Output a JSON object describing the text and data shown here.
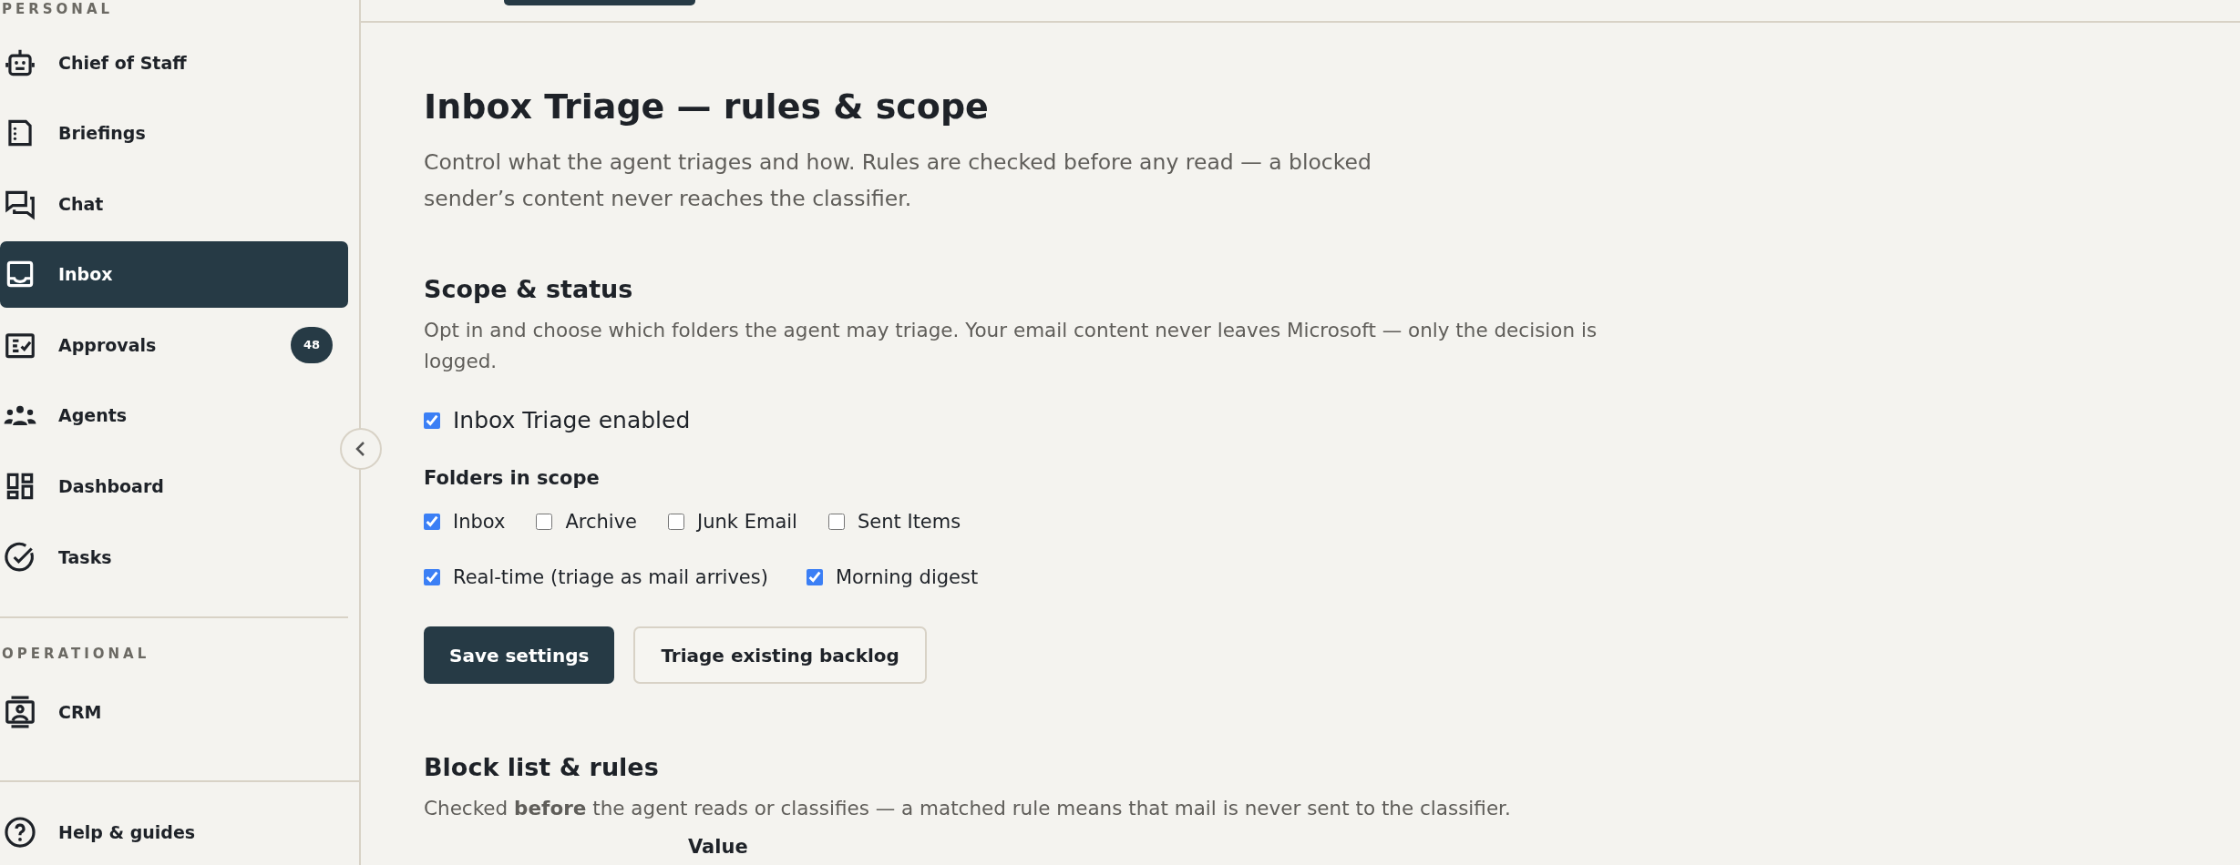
{
  "sidebar": {
    "sections": [
      {
        "title": "PERSONAL",
        "items": [
          {
            "label": "Chief of Staff",
            "selected": false
          },
          {
            "label": "Briefings",
            "selected": false
          },
          {
            "label": "Chat",
            "selected": false
          },
          {
            "label": "Inbox",
            "selected": true
          },
          {
            "label": "Approvals",
            "selected": false,
            "badge": "48"
          },
          {
            "label": "Agents",
            "selected": false
          },
          {
            "label": "Dashboard",
            "selected": false
          },
          {
            "label": "Tasks",
            "selected": false
          }
        ]
      },
      {
        "title": "OPERATIONAL",
        "items": [
          {
            "label": "CRM",
            "selected": false
          }
        ]
      }
    ],
    "footer_item": {
      "label": "Help & guides"
    }
  },
  "main": {
    "title": "Inbox Triage — rules & scope",
    "subtitle": "Control what the agent triages and how. Rules are checked before any read — a blocked sender’s content never reaches the classifier.",
    "scope": {
      "heading": "Scope & status",
      "description": "Opt in and choose which folders the agent may triage. Your email content never leaves Microsoft — only the decision is logged.",
      "enabled": {
        "label": "Inbox Triage enabled",
        "checked": true
      },
      "folders_label": "Folders in scope",
      "folders": [
        {
          "label": "Inbox",
          "checked": true
        },
        {
          "label": "Archive",
          "checked": false
        },
        {
          "label": "Junk Email",
          "checked": false
        },
        {
          "label": "Sent Items",
          "checked": false
        }
      ],
      "modes": [
        {
          "label": "Real-time (triage as mail arrives)",
          "checked": true
        },
        {
          "label": "Morning digest",
          "checked": true
        }
      ],
      "buttons": [
        {
          "label": "Save settings",
          "kind": "primary"
        },
        {
          "label": "Triage existing backlog",
          "kind": "secondary"
        }
      ]
    },
    "block_list": {
      "heading": "Block list & rules",
      "description": "Checked **before** the agent reads or classifies — a matched rule means that mail is never sent to the classifier.",
      "table": {
        "columns": [
          "Value"
        ]
      }
    }
  }
}
